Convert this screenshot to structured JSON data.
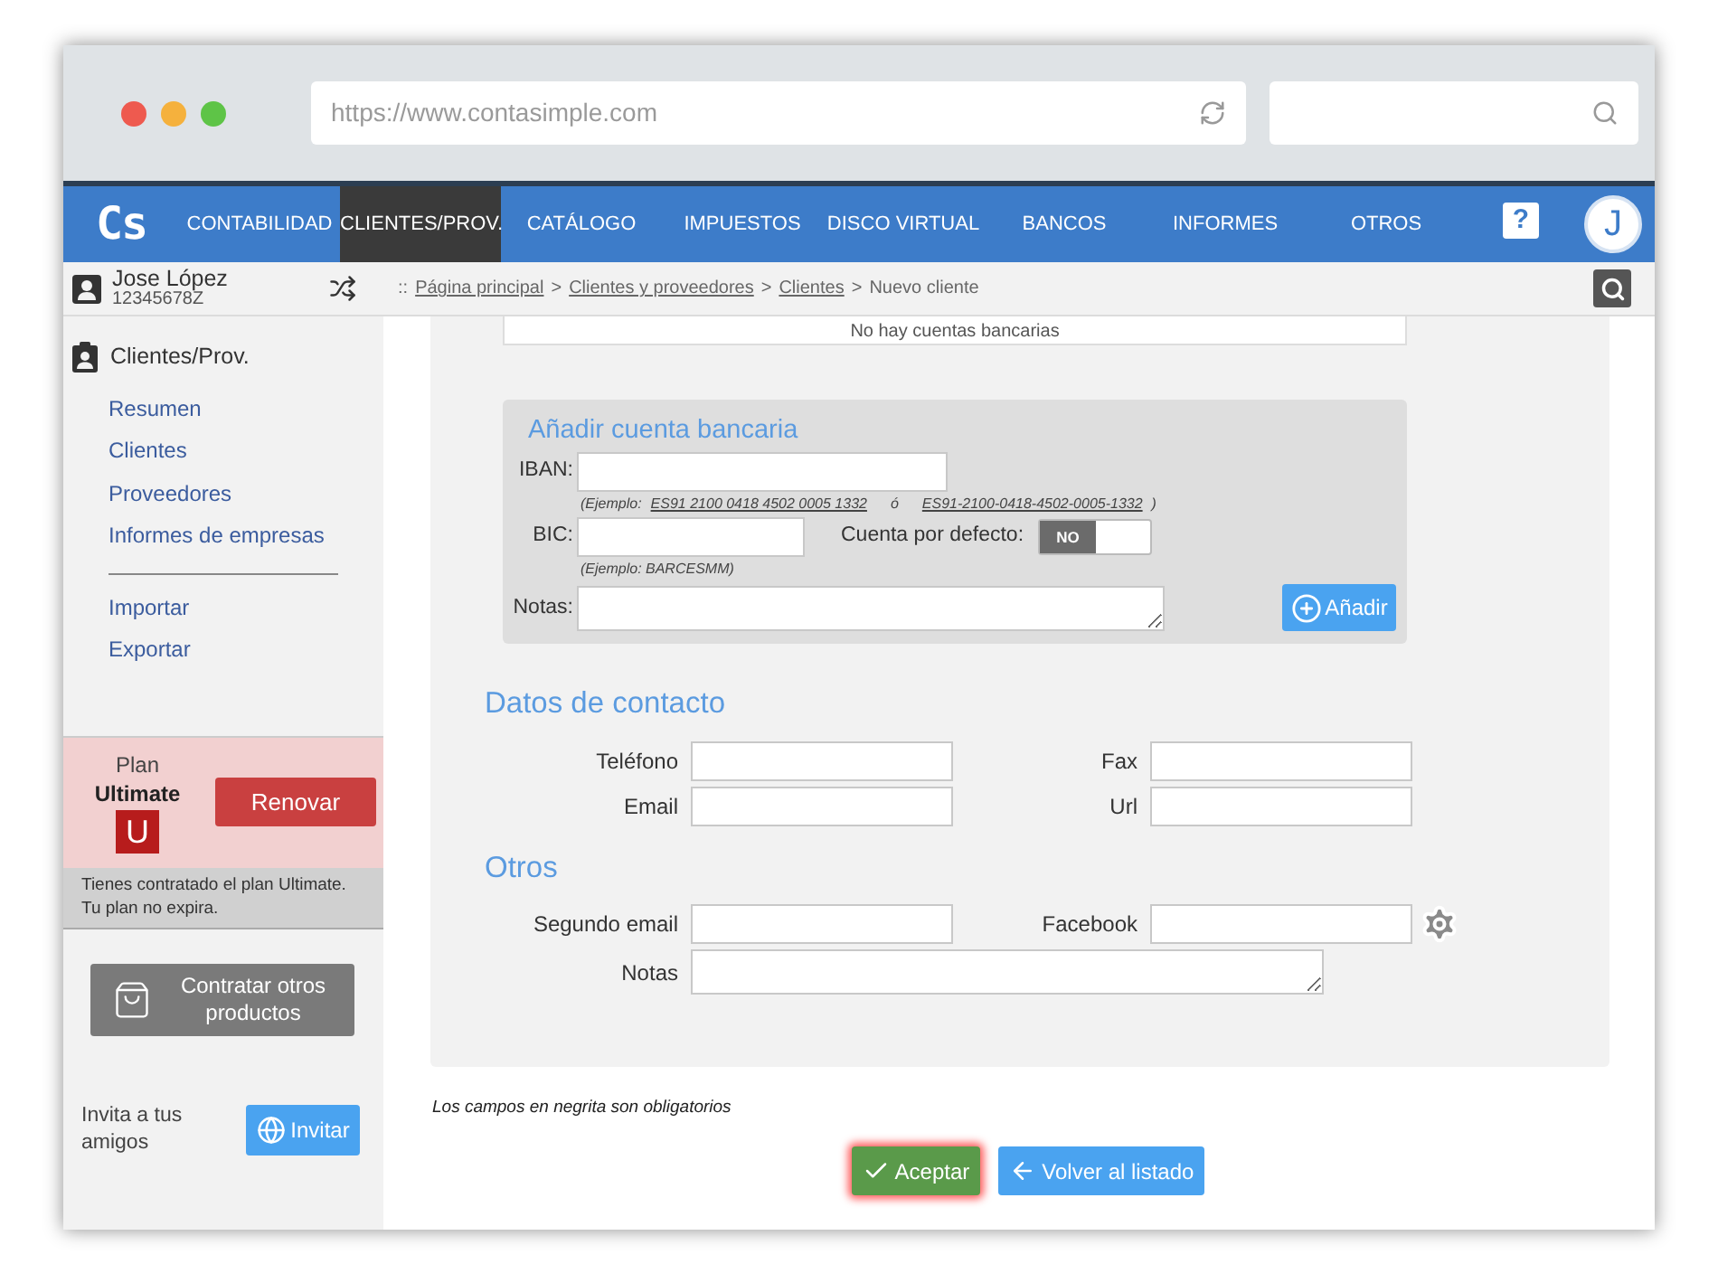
{
  "browser": {
    "url": "https://www.contasimple.com"
  },
  "nav": {
    "logo": "Cs",
    "items": [
      {
        "label": "CONTABILIDAD",
        "selected": false
      },
      {
        "label": "CLIENTES/PROV.",
        "selected": true
      },
      {
        "label": "CATÁLOGO",
        "selected": false
      },
      {
        "label": "IMPUESTOS",
        "selected": false
      },
      {
        "label": "DISCO VIRTUAL",
        "selected": false
      },
      {
        "label": "BANCOS",
        "selected": false
      },
      {
        "label": "INFORMES",
        "selected": false
      },
      {
        "label": "OTROS",
        "selected": false
      }
    ],
    "help": "?",
    "avatar": "J"
  },
  "user": {
    "name": "Jose López",
    "id": "12345678Z"
  },
  "breadcrumb": [
    {
      "kind": "text",
      "text": "::"
    },
    {
      "kind": "link",
      "text": "Página principal"
    },
    {
      "kind": "text",
      "text": ">"
    },
    {
      "kind": "link",
      "text": "Clientes y proveedores"
    },
    {
      "kind": "text",
      "text": ">"
    },
    {
      "kind": "link",
      "text": "Clientes"
    },
    {
      "kind": "text",
      "text": ">"
    },
    {
      "kind": "text",
      "text": "Nuevo cliente"
    }
  ],
  "sidebar": {
    "section": "Clientes/Prov.",
    "groups": [
      [
        "Resumen",
        "Clientes",
        "Proveedores",
        "Informes de empresas"
      ],
      [
        "Importar",
        "Exportar"
      ]
    ]
  },
  "plan": {
    "label": "Plan",
    "name": "Ultimate",
    "badge": "U",
    "button": "Renovar",
    "note": [
      "Tienes contratado el plan Ultimate.",
      "Tu plan no expira."
    ]
  },
  "shop_button": "Contratar otros productos",
  "invite": {
    "text": "Invita a tus amigos",
    "button": "Invitar"
  },
  "bank": {
    "empty": "No hay cuentas bancarias",
    "title": "Añadir cuenta bancaria",
    "iban_label": "IBAN:",
    "iban_hint": [
      {
        "kind": "text",
        "text": "(Ejemplo:"
      },
      {
        "kind": "link",
        "text": "ES91 2100 0418 4502 0005 1332"
      },
      {
        "kind": "text",
        "text": "ó"
      },
      {
        "kind": "link",
        "text": "ES91-2100-0418-4502-0005-1332"
      },
      {
        "kind": "text",
        "text": ")"
      }
    ],
    "bic_label": "BIC:",
    "bic_hint": "(Ejemplo: BARCESMM)",
    "default_label": "Cuenta por defecto:",
    "default_on": false,
    "default_text": "NO",
    "notes_label": "Notas:",
    "add_button": "Añadir"
  },
  "contact": {
    "title": "Datos de contacto",
    "rows": [
      [
        {
          "label": "Teléfono",
          "settings": false
        },
        {
          "label": "Fax",
          "settings": false
        }
      ],
      [
        {
          "label": "Email",
          "settings": false
        },
        {
          "label": "Url",
          "settings": false
        }
      ]
    ]
  },
  "others": {
    "title": "Otros",
    "rows": [
      [
        {
          "label": "Segundo email",
          "settings": false
        },
        {
          "label": "Facebook",
          "settings": true
        }
      ]
    ],
    "notes_label": "Notas"
  },
  "footnote": "Los campos en negrita son obligatorios",
  "actions": [
    {
      "kind": "accept",
      "label": "Aceptar",
      "focused": true
    },
    {
      "kind": "back",
      "label": "Volver al listado",
      "focused": false
    }
  ]
}
